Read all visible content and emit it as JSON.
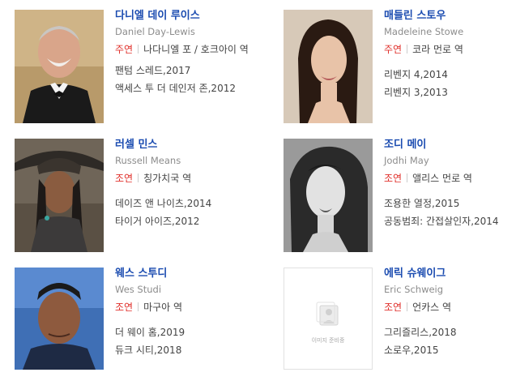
{
  "cast": [
    {
      "name": "다니엘 데이 루이스",
      "eng_name": "Daniel Day-Lewis",
      "role_type": "주연",
      "role": "나다니엘 포 / 호크아이 역",
      "works": [
        "팬텀 스레드,2017",
        "액세스 투 더 데인저 존,2012"
      ]
    },
    {
      "name": "매들린 스토우",
      "eng_name": "Madeleine Stowe",
      "role_type": "주연",
      "role": "코라 먼로 역",
      "works": [
        "리벤지 4,2014",
        "리벤지 3,2013"
      ]
    },
    {
      "name": "러셀 민스",
      "eng_name": "Russell Means",
      "role_type": "조연",
      "role": "칭가치국 역",
      "works": [
        "데이즈 앤 나이츠,2014",
        "타이거 아이즈,2012"
      ]
    },
    {
      "name": "조디 메이",
      "eng_name": "Jodhi May",
      "role_type": "조연",
      "role": "앨리스 먼로 역",
      "works": [
        "조용한 열정,2015",
        "공동범죄: 간접살인자,2014"
      ]
    },
    {
      "name": "웨스 스투디",
      "eng_name": "Wes Studi",
      "role_type": "조연",
      "role": "마구아 역",
      "works": [
        "더 웨이 홈,2019",
        "듀크 시티,2018"
      ]
    },
    {
      "name": "에릭 슈웨이그",
      "eng_name": "Eric Schweig",
      "role_type": "조연",
      "role": "언카스 역",
      "works": [
        "그리즐리스,2018",
        "소로우,2015"
      ],
      "no_image_text": "이미지 준비중"
    }
  ]
}
